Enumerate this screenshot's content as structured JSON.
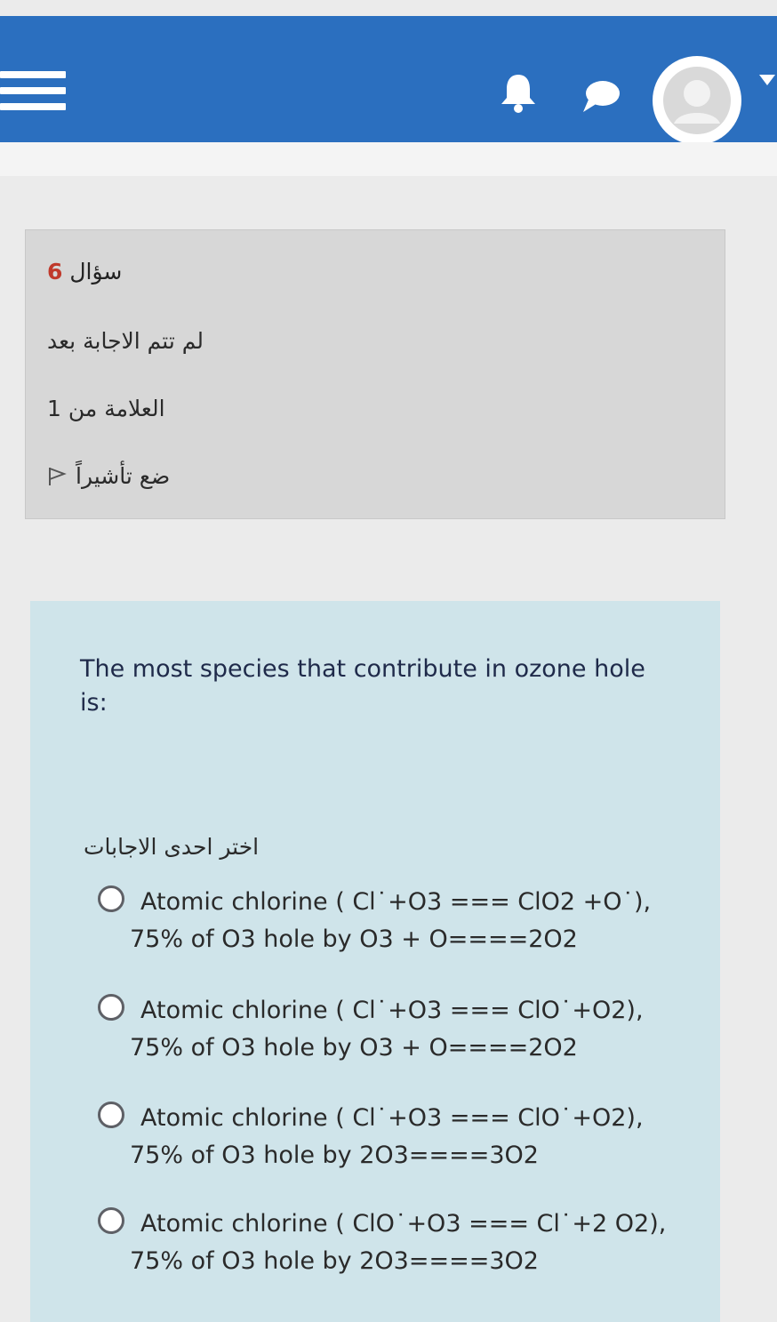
{
  "header": {
    "menu_icon": "hamburger-icon",
    "notification_icon": "bell-icon",
    "messages_icon": "chat-bubble-icon",
    "user_icon": "avatar-icon",
    "user_menu_icon": "caret-down-icon",
    "brand_color": "#2b6fbf"
  },
  "question_info": {
    "label": "سؤال",
    "number": "6",
    "state": "لم تتم الاجابة بعد",
    "mark": "العلامة من 1",
    "flag_label": "ضع تأشيراً",
    "flag_icon": "flag-outline-icon"
  },
  "question": {
    "text": "The most species that contribute in ozone hole is:",
    "prompt": "اختر احدى الاجابات",
    "options": [
      {
        "line1": "Atomic chlorine ( Cl˙+O3 === ClO2 +O˙),",
        "line2": "75% of O3 hole by O3 + O====2O2",
        "selected": false
      },
      {
        "line1": "Atomic chlorine ( Cl˙+O3 === ClO˙+O2),",
        "line2": "75% of O3 hole by O3 + O====2O2",
        "selected": false
      },
      {
        "line1": "Atomic chlorine ( Cl˙+O3 === ClO˙+O2),",
        "line2": "75% of O3 hole by 2O3====3O2",
        "selected": false
      },
      {
        "line1": "Atomic chlorine ( ClO˙+O3 === Cl˙+2 O2),",
        "line2": "75% of O3 hole by 2O3====3O2",
        "selected": false
      }
    ]
  }
}
